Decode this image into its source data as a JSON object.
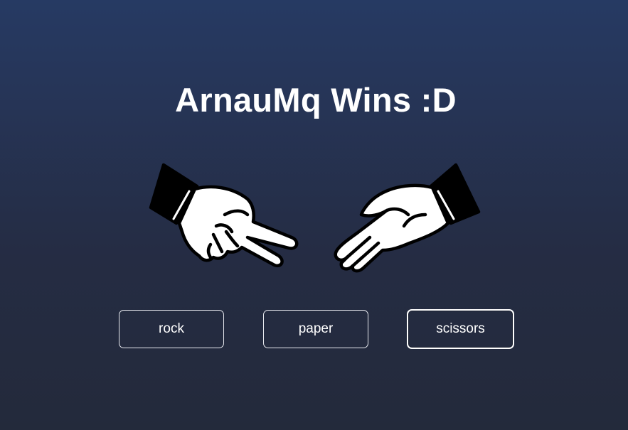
{
  "game": {
    "result_text": "ArnauMq Wins :D"
  },
  "hands": {
    "player": {
      "move": "scissors",
      "icon": "scissors-hand-icon"
    },
    "opponent": {
      "move": "paper",
      "icon": "paper-hand-icon"
    }
  },
  "controls": {
    "rock_label": "rock",
    "paper_label": "paper",
    "scissors_label": "scissors",
    "focused": "scissors"
  },
  "colors": {
    "background_top": "#263a63",
    "background_bottom": "#232a3b",
    "text": "#ffffff"
  }
}
